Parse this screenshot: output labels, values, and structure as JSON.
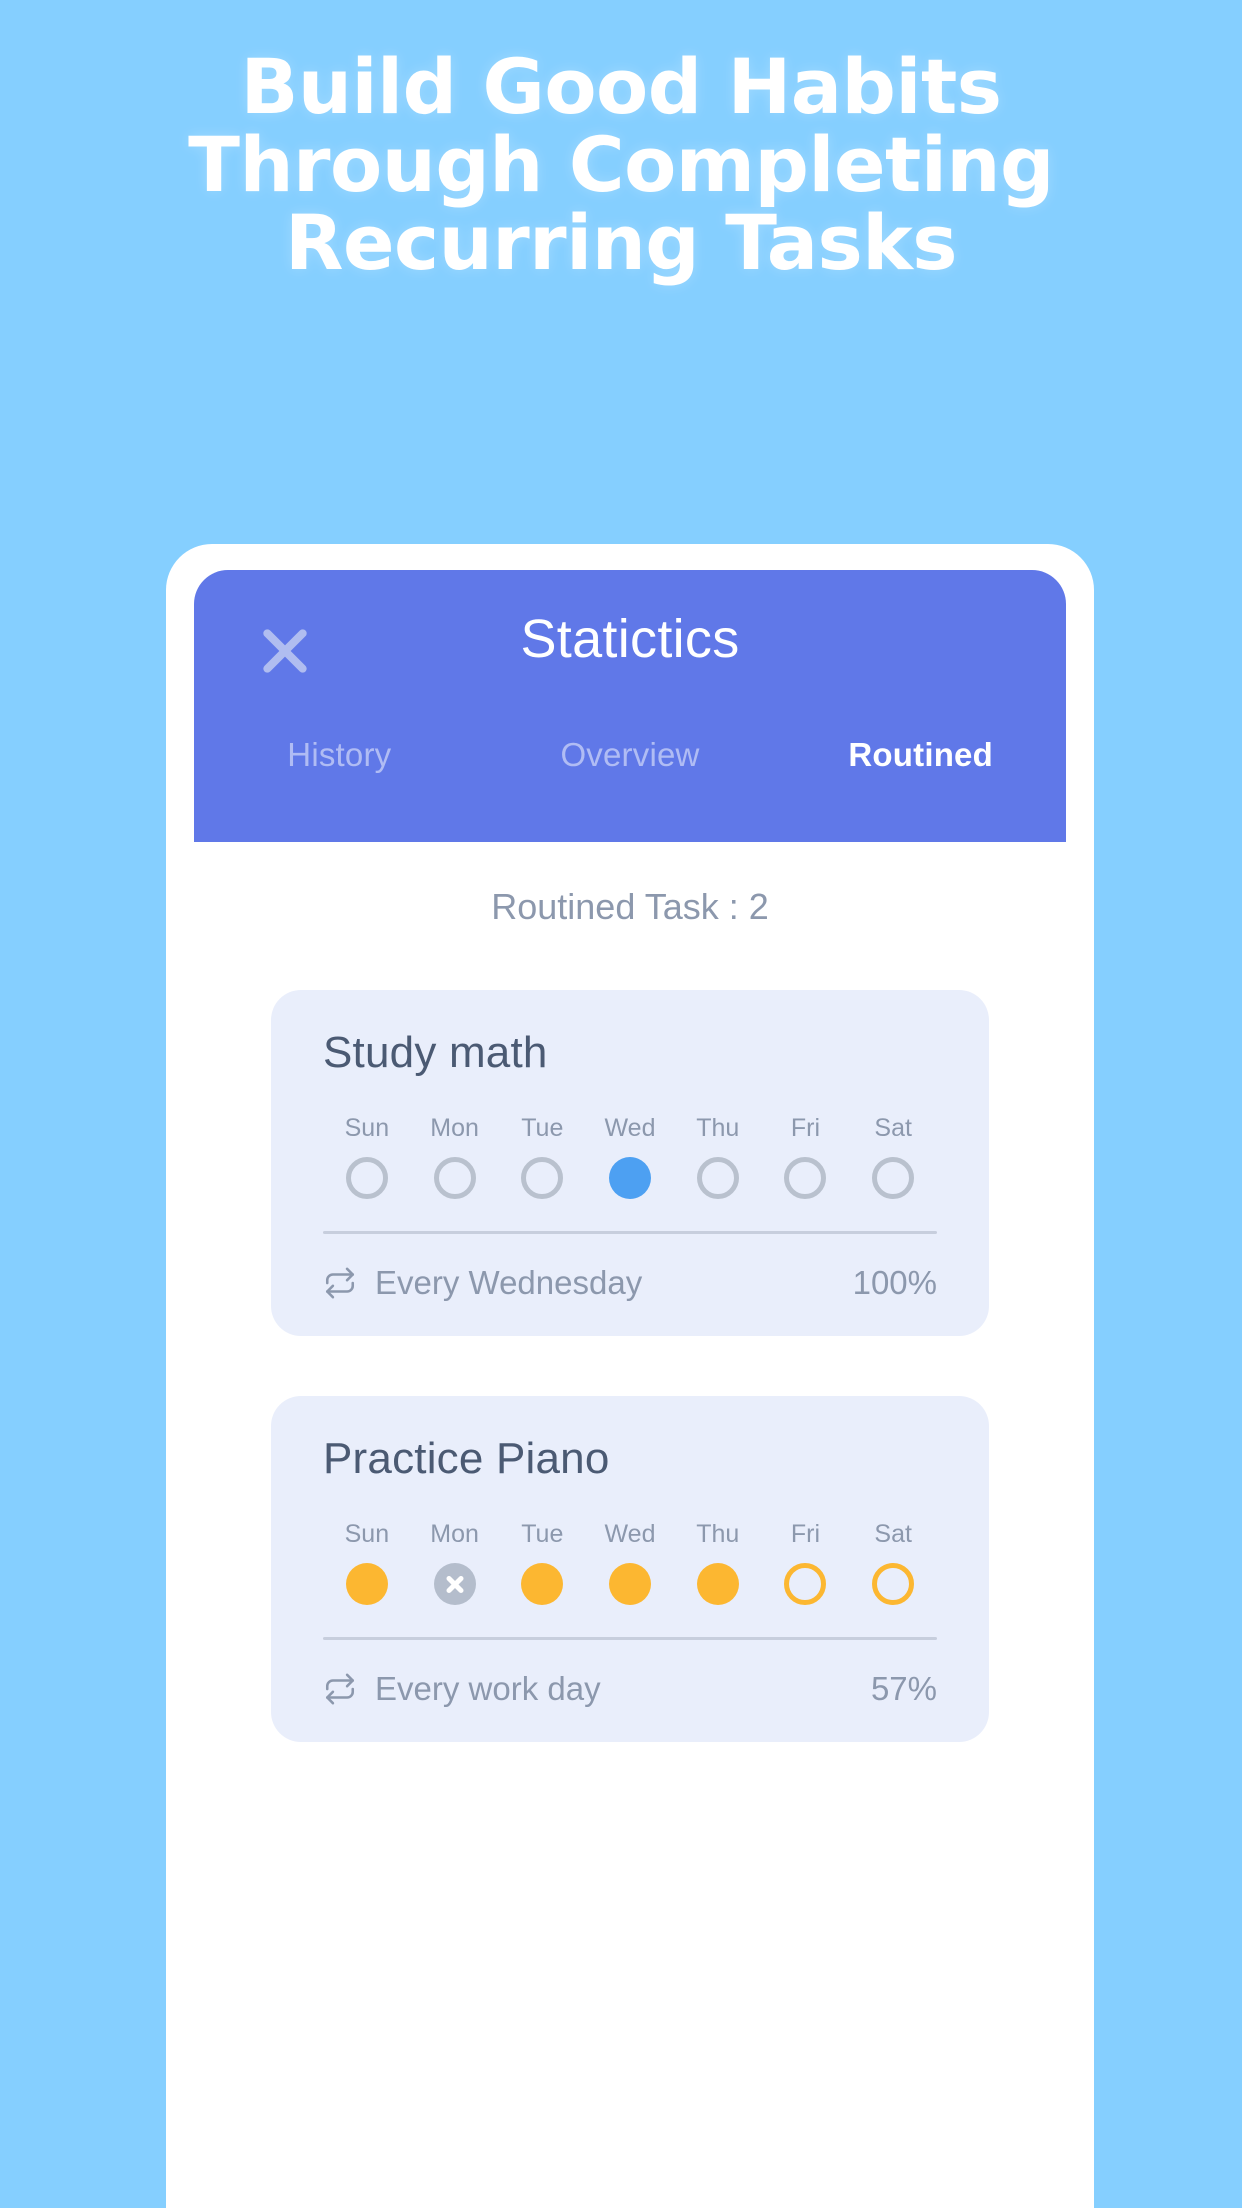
{
  "promo": {
    "headline_lines": [
      "Build Good Habits",
      "Through Completing",
      "Recurring Tasks"
    ],
    "background_color": "#85cfff",
    "headline_color": "#ffffff"
  },
  "app": {
    "header": {
      "title": "Statictics",
      "close_icon": "close-icon",
      "background_color": "#6078e8",
      "tabs": [
        {
          "label": "History",
          "active": false
        },
        {
          "label": "Overview",
          "active": false
        },
        {
          "label": "Routined",
          "active": true
        }
      ]
    },
    "content": {
      "summary": "Routined Task : 2",
      "day_labels": [
        "Sun",
        "Mon",
        "Tue",
        "Wed",
        "Thu",
        "Fri",
        "Sat"
      ],
      "cards": [
        {
          "title": "Study math",
          "days": [
            {
              "label": "Sun",
              "state": "empty-gray"
            },
            {
              "label": "Mon",
              "state": "empty-gray"
            },
            {
              "label": "Tue",
              "state": "empty-gray"
            },
            {
              "label": "Wed",
              "state": "filled-blue"
            },
            {
              "label": "Thu",
              "state": "empty-gray"
            },
            {
              "label": "Fri",
              "state": "empty-gray"
            },
            {
              "label": "Sat",
              "state": "empty-gray"
            }
          ],
          "repeat_icon": "repeat-icon",
          "repeat_label": "Every Wednesday",
          "percent": "100%",
          "accent_color": "#4da0f2"
        },
        {
          "title": "Practice Piano",
          "days": [
            {
              "label": "Sun",
              "state": "filled-orange"
            },
            {
              "label": "Mon",
              "state": "skip-gray"
            },
            {
              "label": "Tue",
              "state": "filled-orange"
            },
            {
              "label": "Wed",
              "state": "filled-orange"
            },
            {
              "label": "Thu",
              "state": "filled-orange"
            },
            {
              "label": "Fri",
              "state": "empty-orange"
            },
            {
              "label": "Sat",
              "state": "empty-orange"
            }
          ],
          "repeat_icon": "repeat-icon",
          "repeat_label": "Every work day",
          "percent": "57%",
          "accent_color": "#fcb731"
        }
      ],
      "card_background": "#e9eefb"
    }
  }
}
